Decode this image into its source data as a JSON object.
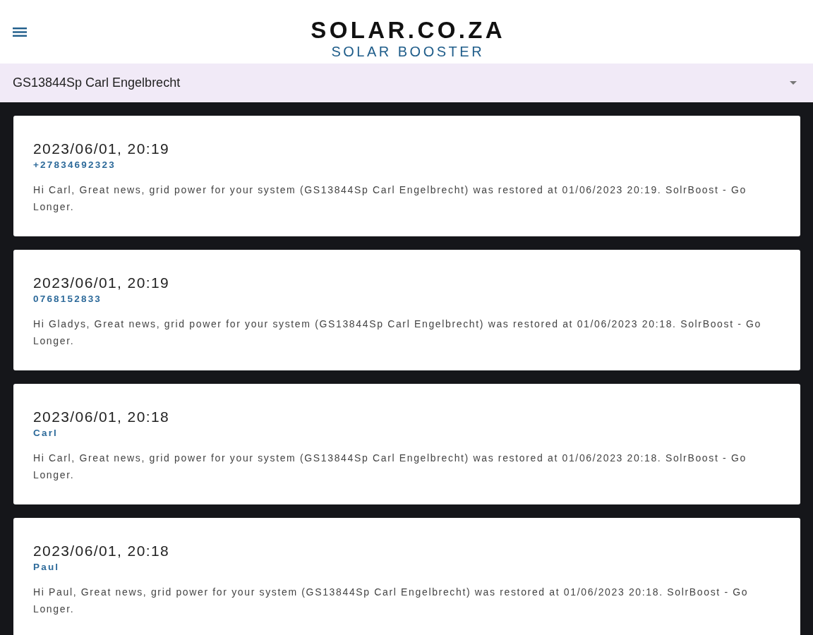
{
  "header": {
    "logo_title": "SOLAR.CO.ZA",
    "logo_subtitle": "SOLAR BOOSTER"
  },
  "system_select": {
    "value": "GS13844Sp Carl Engelbrecht"
  },
  "messages": [
    {
      "timestamp": "2023/06/01, 20:19",
      "sender": "+27834692323",
      "text": "Hi Carl, Great news, grid power for your system (GS13844Sp Carl Engelbrecht) was restored at 01/06/2023 20:19. SolrBoost - Go Longer."
    },
    {
      "timestamp": "2023/06/01, 20:19",
      "sender": "0768152833",
      "text": "Hi Gladys, Great news, grid power for your system (GS13844Sp Carl Engelbrecht) was restored at 01/06/2023 20:18. SolrBoost - Go Longer."
    },
    {
      "timestamp": "2023/06/01, 20:18",
      "sender": "Carl",
      "text": "Hi Carl, Great news, grid power for your system (GS13844Sp Carl Engelbrecht) was restored at 01/06/2023 20:18. SolrBoost - Go Longer."
    },
    {
      "timestamp": "2023/06/01, 20:18",
      "sender": "Paul",
      "text": "Hi Paul, Great news, grid power for your system (GS13844Sp Carl Engelbrecht) was restored at 01/06/2023 20:18. SolrBoost - Go Longer."
    }
  ]
}
